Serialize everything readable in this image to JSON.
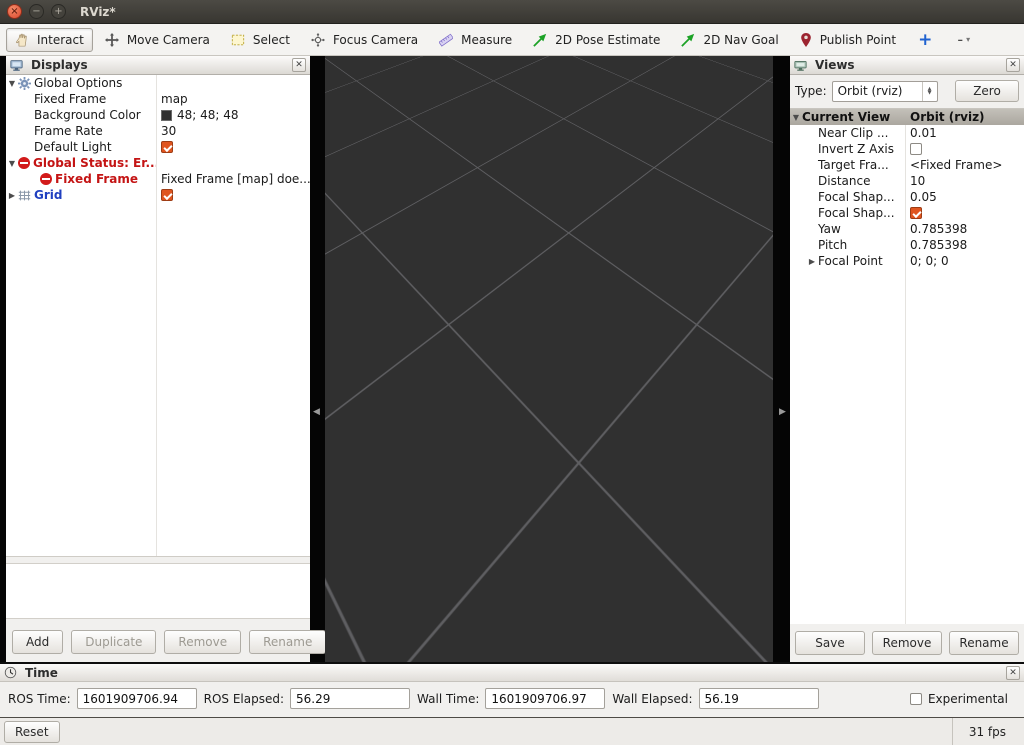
{
  "titlebar": {
    "title": "RViz*"
  },
  "toolbar": {
    "tools": [
      {
        "label": "Interact"
      },
      {
        "label": "Move Camera"
      },
      {
        "label": "Select"
      },
      {
        "label": "Focus Camera"
      },
      {
        "label": "Measure"
      },
      {
        "label": "2D Pose Estimate"
      },
      {
        "label": "2D Nav Goal"
      },
      {
        "label": "Publish Point"
      }
    ],
    "add_tool": "+",
    "remove_tool": "-"
  },
  "displays": {
    "title": "Displays",
    "rows": [
      {
        "label": "Global Options",
        "value": ""
      },
      {
        "label": "Fixed Frame",
        "value": "map"
      },
      {
        "label": "Background Color",
        "value": "48; 48; 48"
      },
      {
        "label": "Frame Rate",
        "value": "30"
      },
      {
        "label": "Default Light",
        "value": ""
      },
      {
        "label": "Global Status: Er...",
        "value": ""
      },
      {
        "label": "Fixed Frame",
        "value": "Fixed Frame [map] doe..."
      },
      {
        "label": "Grid",
        "value": ""
      }
    ],
    "buttons": {
      "add": "Add",
      "duplicate": "Duplicate",
      "remove": "Remove",
      "rename": "Rename"
    }
  },
  "views": {
    "title": "Views",
    "type_label": "Type:",
    "type_value": "Orbit (rviz)",
    "zero": "Zero",
    "rows": [
      {
        "label": "Current View",
        "value": "Orbit (rviz)"
      },
      {
        "label": "Near Clip ...",
        "value": "0.01"
      },
      {
        "label": "Invert Z Axis",
        "value": ""
      },
      {
        "label": "Target Fra...",
        "value": "<Fixed Frame>"
      },
      {
        "label": "Distance",
        "value": "10"
      },
      {
        "label": "Focal Shap...",
        "value": "0.05"
      },
      {
        "label": "Focal Shap...",
        "value": ""
      },
      {
        "label": "Yaw",
        "value": "0.785398"
      },
      {
        "label": "Pitch",
        "value": "0.785398"
      },
      {
        "label": "Focal Point",
        "value": "0; 0; 0"
      }
    ],
    "buttons": {
      "save": "Save",
      "remove": "Remove",
      "rename": "Rename"
    }
  },
  "time": {
    "title": "Time",
    "fields": [
      {
        "label": "ROS Time:",
        "value": "1601909706.94"
      },
      {
        "label": "ROS Elapsed:",
        "value": "56.29"
      },
      {
        "label": "Wall Time:",
        "value": "1601909706.97"
      },
      {
        "label": "Wall Elapsed:",
        "value": "56.19"
      }
    ],
    "experimental": "Experimental"
  },
  "statusbar": {
    "reset": "Reset",
    "fps": "31 fps"
  },
  "colors": {
    "viewport_bg": "#303030",
    "grid_line": "#5e5e61",
    "checkbox_orange": "#e0551f",
    "error_red": "#c41414",
    "display_blue": "#2040c0"
  }
}
